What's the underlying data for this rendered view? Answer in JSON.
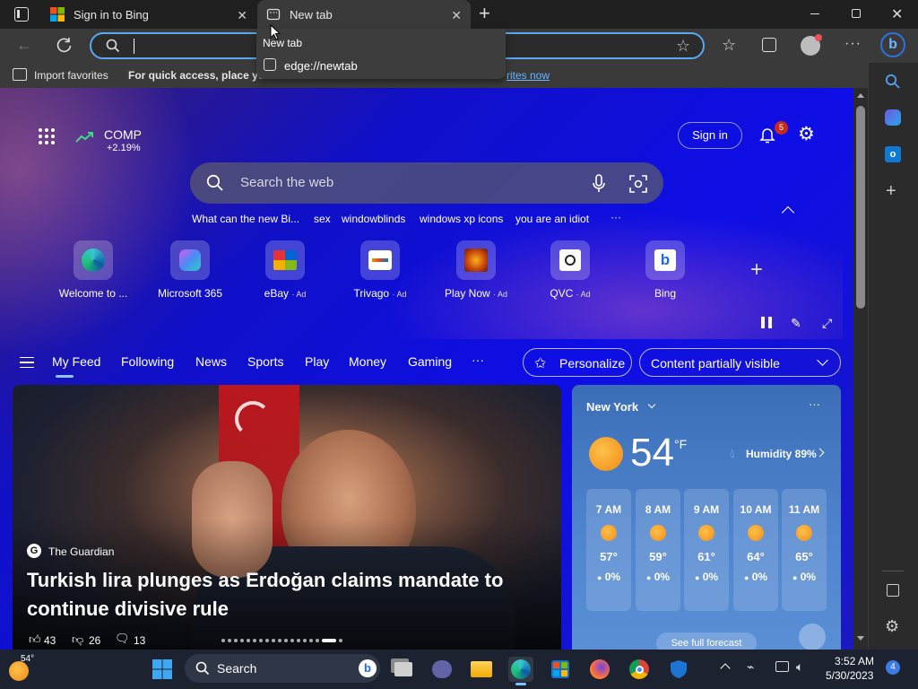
{
  "tabs": [
    {
      "title": "Sign in to Bing",
      "active": false
    },
    {
      "title": "New tab",
      "active": true
    }
  ],
  "dropdown": {
    "header": "New tab",
    "suggestion": "edge://newtab"
  },
  "favorites_bar": {
    "import_label": "Import favorites",
    "hint_prefix": "For quick access, place you",
    "hint_link": "rites now"
  },
  "header": {
    "stock_symbol": "COMP",
    "stock_change": "+2.19%",
    "sign_in": "Sign in",
    "notification_count": "5"
  },
  "search": {
    "placeholder": "Search the web"
  },
  "trending": [
    "What can the new Bi...",
    "sex",
    "windowblinds",
    "windows xp icons",
    "you are an idiot",
    "···"
  ],
  "quick_links": [
    {
      "label": "Welcome to ...",
      "ad": ""
    },
    {
      "label": "Microsoft 365",
      "ad": ""
    },
    {
      "label": "eBay",
      "ad": "· Ad"
    },
    {
      "label": "Trivago",
      "ad": "· Ad"
    },
    {
      "label": "Play Now",
      "ad": "· Ad"
    },
    {
      "label": "QVC",
      "ad": "· Ad"
    },
    {
      "label": "Bing",
      "ad": ""
    }
  ],
  "feed_nav": [
    "My Feed",
    "Following",
    "News",
    "Sports",
    "Play",
    "Money",
    "Gaming",
    "···"
  ],
  "personalize": "Personalize",
  "content_visibility": "Content partially visible",
  "hero": {
    "source": "The Guardian",
    "headline_line1": "Turkish lira plunges as Erdoğan claims mandate to",
    "headline_line2": "continue divisive rule",
    "likes": "43",
    "dislikes": "26",
    "comments": "13"
  },
  "weather": {
    "city": "New York",
    "temp": "54",
    "unit": "°F",
    "humidity": "Humidity 89%",
    "hours": [
      {
        "time": "7 AM",
        "temp": "57°",
        "precip": "0%"
      },
      {
        "time": "8 AM",
        "temp": "59°",
        "precip": "0%"
      },
      {
        "time": "9 AM",
        "temp": "61°",
        "precip": "0%"
      },
      {
        "time": "10 AM",
        "temp": "64°",
        "precip": "0%"
      },
      {
        "time": "11 AM",
        "temp": "65°",
        "precip": "0%"
      }
    ],
    "forecast_link": "See full forecast"
  },
  "taskbar": {
    "weather_temp": "54°",
    "search_label": "Search",
    "time": "3:52 AM",
    "date": "5/30/2023",
    "notif_count": "4"
  },
  "colors": {
    "accent": "#5aa8f0",
    "badge": "#c42b1c",
    "content_bg": "#0e0ee6"
  }
}
